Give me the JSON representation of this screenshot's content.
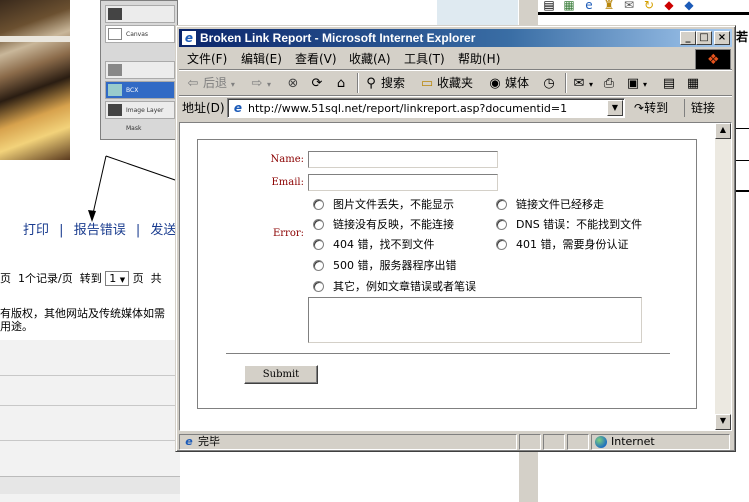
{
  "background_page": {
    "links": [
      "打印",
      "报告错误",
      "发送"
    ],
    "link_separator": "|",
    "paging": {
      "prefix": "页",
      "record": "1个记录/页",
      "goto": "转到",
      "page_value": "1",
      "page_suffix": "页",
      "trailing": "共"
    },
    "copyright_line1": "有版权，其他网站及传统媒体如需",
    "copyright_line2": "用途。",
    "side_panel_rows": [
      "",
      "Canvas",
      "",
      "BCX",
      "Image Layer Mask"
    ],
    "right_page_partial": "文若"
  },
  "window": {
    "title": "Broken Link Report - Microsoft Internet Explorer",
    "controls": {
      "minimize": "_",
      "maximize": "□",
      "close": "×"
    },
    "menu": [
      "文件(F)",
      "编辑(E)",
      "查看(V)",
      "收藏(A)",
      "工具(T)",
      "帮助(H)"
    ],
    "toolbar": {
      "back": "后退",
      "search": "搜索",
      "favorites": "收藏夹",
      "media": "媒体"
    },
    "address": {
      "label": "地址(D)",
      "url": "http://www.51sql.net/report/linkreport.asp?documentid=1",
      "go": "转到",
      "links": "链接"
    },
    "status": {
      "text": "完毕",
      "zone": "Internet"
    }
  },
  "form": {
    "name_label": "Name:",
    "email_label": "Email:",
    "error_label": "Error:",
    "name_value": "",
    "email_value": "",
    "error_options": [
      "图片文件丢失，不能显示",
      "链接文件已经移走",
      "链接没有反映，不能连接",
      "DNS 错误：不能找到文件",
      "404 错，找不到文件",
      "401 错，需要身份认证",
      "500 错，服务器程序出错",
      "其它，例如文章错误或者笔误"
    ],
    "comment_value": "",
    "submit_label": "Submit"
  },
  "colors": {
    "title_start": "#0a246a",
    "title_end": "#a6caf0",
    "form_label": "#8b0000",
    "link": "#1a3c8f"
  }
}
